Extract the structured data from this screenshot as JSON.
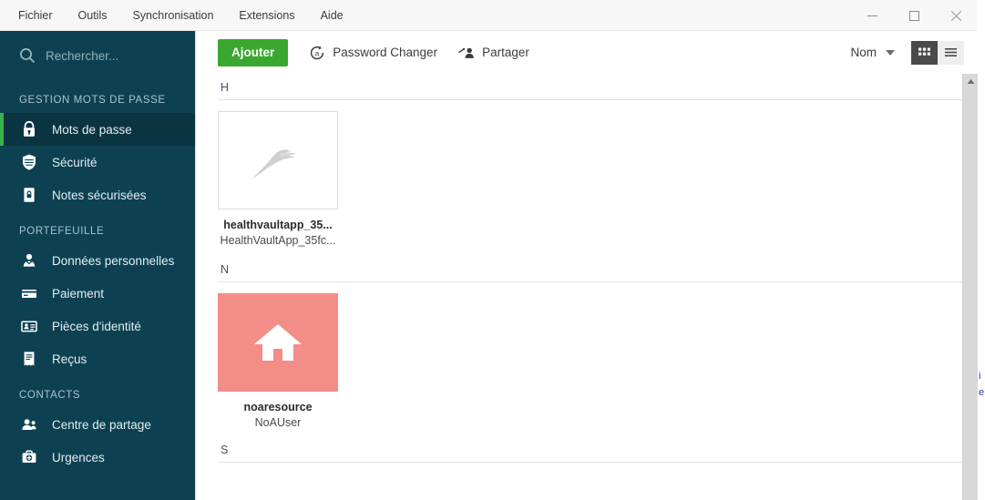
{
  "window": {
    "menu": [
      {
        "label": "Fichier",
        "name": "menu-fichier"
      },
      {
        "label": "Outils",
        "name": "menu-outils"
      },
      {
        "label": "Synchronisation",
        "name": "menu-synchronisation"
      },
      {
        "label": "Extensions",
        "name": "menu-extensions"
      },
      {
        "label": "Aide",
        "name": "menu-aide"
      }
    ],
    "controls": {
      "minimize": "minimize-icon",
      "maximize": "maximize-icon",
      "close": "close-icon"
    }
  },
  "background_window": {
    "line1": "i",
    "line2": "e"
  },
  "sidebar": {
    "search": {
      "placeholder": "Rechercher...",
      "value": "",
      "icon": "search-icon"
    },
    "groups": [
      {
        "label": "GESTION MOTS DE PASSE",
        "items": [
          {
            "label": "Mots de passe",
            "icon": "lock-icon",
            "active": true
          },
          {
            "label": "Sécurité",
            "icon": "shield-icon",
            "active": false
          },
          {
            "label": "Notes sécurisées",
            "icon": "secure-note-icon",
            "active": false
          }
        ]
      },
      {
        "label": "PORTEFEUILLE",
        "items": [
          {
            "label": "Données personnelles",
            "icon": "person-icon",
            "active": false
          },
          {
            "label": "Paiement",
            "icon": "credit-card-icon",
            "active": false
          },
          {
            "label": "Pièces d'identité",
            "icon": "id-card-icon",
            "active": false
          },
          {
            "label": "Reçus",
            "icon": "receipt-icon",
            "active": false
          }
        ]
      },
      {
        "label": "CONTACTS",
        "items": [
          {
            "label": "Centre de partage",
            "icon": "people-icon",
            "active": false
          },
          {
            "label": "Urgences",
            "icon": "emergency-kit-icon",
            "active": false
          }
        ]
      }
    ],
    "accent_color": "#37b34a",
    "background_color": "#0d4152",
    "active_background_color": "#0a3442"
  },
  "toolbar": {
    "add_label": "Ajouter",
    "add_color": "#3aa830",
    "password_changer_label": "Password Changer",
    "password_changer_icon": "password-changer-icon",
    "share_label": "Partager",
    "share_icon": "share-person-icon",
    "sort_label": "Nom",
    "sort_caret_icon": "chevron-down-icon",
    "view_grid_icon": "grid-view-icon",
    "view_list_icon": "list-view-icon",
    "view_selected": "grid"
  },
  "list": {
    "groups": [
      {
        "letter": "H",
        "items": [
          {
            "title": "healthvaultapp_35...",
            "subtitle": "HealthVaultApp_35fc...",
            "tile_style": "logo",
            "tile_color": "#ffffff",
            "icon": "healthvault-logo-icon"
          }
        ]
      },
      {
        "letter": "N",
        "items": [
          {
            "title": "noaresource",
            "subtitle": "NoAUser",
            "tile_style": "solid",
            "tile_color": "#f28e87",
            "icon": "home-icon"
          }
        ]
      },
      {
        "letter": "S",
        "items": []
      }
    ]
  },
  "scrollbar": {
    "up_arrow_icon": "scroll-up-arrow-icon",
    "down_arrow_icon": "scroll-down-arrow-icon"
  }
}
